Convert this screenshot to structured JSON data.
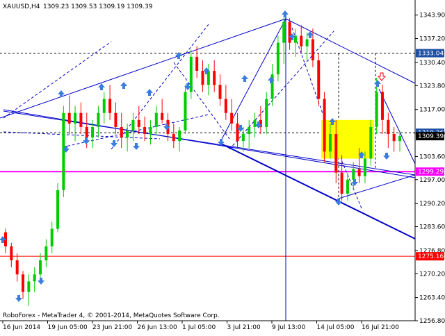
{
  "header": {
    "symbol_timeframe": "XAUUSD,H4",
    "ohlc": "1309.23 1309.53 1309.19 1309.39"
  },
  "watermark": "RoboForex - MetaTrader 4, © 2001-2014, MetaQuotes Software Corp.",
  "colors": {
    "bull": "#00cc00",
    "bear": "#ff0000",
    "trend": "#0000cc",
    "fractal": "#3a7ddf",
    "magenta": "#ff00ff",
    "highlight": "#ffff00",
    "price_tag": "#1e4fa3"
  },
  "price_scale": {
    "ticks": [
      "1343.90",
      "1337.20",
      "1330.40",
      "1323.80",
      "1317.00",
      "1310.20",
      "1303.60",
      "1297.00",
      "1290.20",
      "1283.60",
      "1276.80",
      "1270.20",
      "1263.40",
      "1256.80"
    ],
    "tagged_levels": [
      {
        "label": "1333.04",
        "value": 1333.04,
        "style": "tag-blue"
      },
      {
        "label": "1310.36",
        "value": 1310.36,
        "style": "tag-blue"
      },
      {
        "label": "1309.39",
        "value": 1309.39,
        "style": "tag-black"
      },
      {
        "label": "1299.29",
        "value": 1299.29,
        "style": "tag-magenta"
      },
      {
        "label": "1275.16",
        "value": 1275.16,
        "style": "tag-red"
      }
    ]
  },
  "time_scale": {
    "labels": [
      "16 Jun 2014",
      "19 Jun 05:00",
      "23 Jun 21:00",
      "26 Jun 13:00",
      "1 Jul 05:00",
      "3 Jul 21:00",
      "9 Jul 13:00",
      "14 Jul 05:00",
      "16 Jul 21:00"
    ]
  },
  "chart_data": {
    "type": "candlestick",
    "symbol": "XAUUSD",
    "timeframe": "H4",
    "ylim": [
      1256.8,
      1347
    ],
    "horizontal_levels": [
      1333.04,
      1310.36,
      1299.29,
      1275.16
    ],
    "candles": [
      [
        1282,
        1283,
        1276,
        1278
      ],
      [
        1278,
        1279,
        1272,
        1274
      ],
      [
        1274,
        1276,
        1268,
        1270
      ],
      [
        1270,
        1271,
        1263,
        1265
      ],
      [
        1265,
        1270,
        1261,
        1268
      ],
      [
        1268,
        1272,
        1265,
        1270
      ],
      [
        1270,
        1276,
        1268,
        1274
      ],
      [
        1274,
        1280,
        1272,
        1278
      ],
      [
        1278,
        1285,
        1276,
        1283
      ],
      [
        1283,
        1296,
        1282,
        1294
      ],
      [
        1294,
        1318,
        1292,
        1316
      ],
      [
        1316,
        1321,
        1310,
        1313
      ],
      [
        1313,
        1318,
        1308,
        1316
      ],
      [
        1316,
        1319,
        1310,
        1312
      ],
      [
        1312,
        1316,
        1306,
        1309
      ],
      [
        1309,
        1314,
        1306,
        1312
      ],
      [
        1312,
        1318,
        1309,
        1316
      ],
      [
        1316,
        1322,
        1313,
        1320
      ],
      [
        1320,
        1324,
        1314,
        1316
      ],
      [
        1316,
        1319,
        1310,
        1312
      ],
      [
        1312,
        1316,
        1306,
        1309
      ],
      [
        1309,
        1313,
        1305,
        1311
      ],
      [
        1311,
        1316,
        1308,
        1314
      ],
      [
        1314,
        1318,
        1310,
        1312
      ],
      [
        1312,
        1315,
        1308,
        1310
      ],
      [
        1310,
        1314,
        1307,
        1312
      ],
      [
        1312,
        1318,
        1310,
        1316
      ],
      [
        1316,
        1320,
        1313,
        1314
      ],
      [
        1314,
        1316,
        1308,
        1310
      ],
      [
        1310,
        1313,
        1306,
        1308
      ],
      [
        1308,
        1312,
        1305,
        1311
      ],
      [
        1311,
        1324,
        1310,
        1322
      ],
      [
        1322,
        1334,
        1320,
        1332
      ],
      [
        1332,
        1335,
        1326,
        1328
      ],
      [
        1328,
        1331,
        1322,
        1324
      ],
      [
        1324,
        1330,
        1321,
        1328
      ],
      [
        1328,
        1331,
        1322,
        1324
      ],
      [
        1324,
        1327,
        1318,
        1320
      ],
      [
        1320,
        1324,
        1314,
        1316
      ],
      [
        1316,
        1320,
        1311,
        1313
      ],
      [
        1313,
        1316,
        1306,
        1308
      ],
      [
        1308,
        1312,
        1305,
        1310
      ],
      [
        1310,
        1314,
        1306,
        1312
      ],
      [
        1312,
        1316,
        1309,
        1314
      ],
      [
        1314,
        1318,
        1310,
        1312
      ],
      [
        1312,
        1322,
        1310,
        1320
      ],
      [
        1320,
        1330,
        1318,
        1327
      ],
      [
        1327,
        1338,
        1325,
        1336
      ],
      [
        1336,
        1344,
        1330,
        1342
      ],
      [
        1342,
        1343,
        1334,
        1336
      ],
      [
        1336,
        1340,
        1332,
        1338
      ],
      [
        1338,
        1341,
        1333,
        1335
      ],
      [
        1335,
        1339,
        1331,
        1337
      ],
      [
        1337,
        1340,
        1329,
        1331
      ],
      [
        1331,
        1333,
        1318,
        1320
      ],
      [
        1320,
        1322,
        1302,
        1305
      ],
      [
        1305,
        1313,
        1303,
        1310
      ],
      [
        1310,
        1314,
        1296,
        1299
      ],
      [
        1299,
        1304,
        1291,
        1293
      ],
      [
        1293,
        1299,
        1291,
        1297
      ],
      [
        1297,
        1302,
        1294,
        1300
      ],
      [
        1300,
        1306,
        1296,
        1298
      ],
      [
        1298,
        1305,
        1296,
        1303
      ],
      [
        1303,
        1314,
        1301,
        1312
      ],
      [
        1312,
        1326,
        1310,
        1322
      ],
      [
        1322,
        1324,
        1310,
        1314
      ],
      [
        1314,
        1316,
        1306,
        1310
      ],
      [
        1310,
        1312,
        1305,
        1308
      ],
      [
        1308,
        1311,
        1305,
        1309.39
      ]
    ]
  }
}
